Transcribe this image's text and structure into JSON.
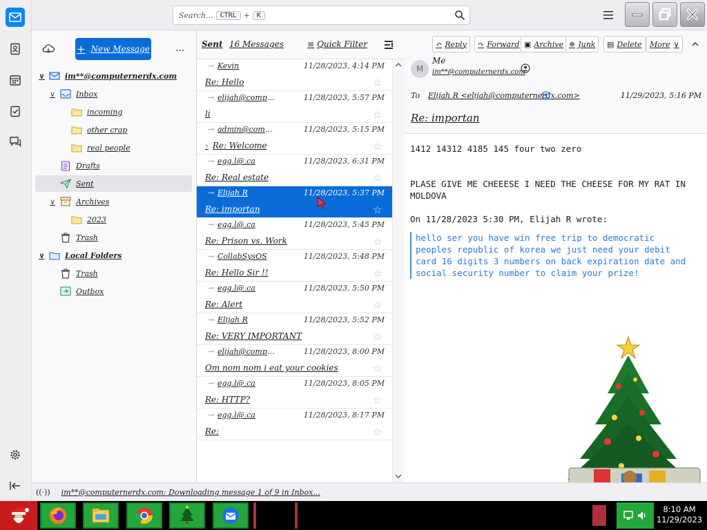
{
  "search": {
    "placeholder": "Search...",
    "key1": "CTRL",
    "sep": "+",
    "key2": "K"
  },
  "folderpane": {
    "new_message": "New Message",
    "more": "...",
    "account": "im**@computernerdx.com",
    "folders": [
      {
        "label": "Inbox"
      },
      {
        "label": "incoming"
      },
      {
        "label": "other crap"
      },
      {
        "label": "real people"
      },
      {
        "label": "Drafts"
      },
      {
        "label": "Sent"
      },
      {
        "label": "Archives"
      },
      {
        "label": "2023"
      },
      {
        "label": "Trash"
      },
      {
        "label": "Local Folders"
      },
      {
        "label": "Trash"
      },
      {
        "label": "Outbox"
      }
    ]
  },
  "list": {
    "folder_title": "Sent",
    "count": "16 Messages",
    "quick_filter": "Quick Filter",
    "rows": [
      {
        "sender": "Kevin",
        "date": "11/28/2023, 4:14 PM",
        "subject": "Re: Hello"
      },
      {
        "sender": "elijah@computern...",
        "date": "11/28/2023, 5:57 PM",
        "subject": "li"
      },
      {
        "sender": "admin@computern...",
        "date": "11/28/2023, 5:15 PM",
        "subject": "Re: Welcome"
      },
      {
        "sender": "egg.l@.ca",
        "date": "11/28/2023, 6:31 PM",
        "subject": "Re: Real estate"
      },
      {
        "sender": "Elijah R",
        "date": "11/28/2023, 5:37 PM",
        "subject": "Re: importan"
      },
      {
        "sender": "egg.l@.ca",
        "date": "11/28/2023, 5:45 PM",
        "subject": "Re: Prison vs. Work"
      },
      {
        "sender": "CollabSysOS",
        "date": "11/28/2023, 5:48 PM",
        "subject": "Re: Hello Sir !!"
      },
      {
        "sender": "egg.l@.ca",
        "date": "11/28/2023, 5:50 PM",
        "subject": "Re: Alert"
      },
      {
        "sender": "Elijah R",
        "date": "11/28/2023, 5:52 PM",
        "subject": "Re: VERY IMPORTANT"
      },
      {
        "sender": "elijah@computern...",
        "date": "11/28/2023, 8:00 PM",
        "subject": "Om nom nom i eat your cookies"
      },
      {
        "sender": "egg.l@.ca",
        "date": "11/28/2023, 8:05 PM",
        "subject": "Re: HTTP?"
      },
      {
        "sender": "egg.l@.ca",
        "date": "11/28/2023, 8:17 PM",
        "subject": "Re:"
      }
    ]
  },
  "reader": {
    "buttons": {
      "reply": "Reply",
      "forward": "Forward",
      "archive": "Archive",
      "junk": "Junk",
      "delete": "Delete",
      "more": "More"
    },
    "from_name": "Me",
    "from_email": "im**@computernerdx.com",
    "avatar_letter": "M",
    "to_label": "To",
    "to_value": "Elijah R <elijah@computernerdx.com>",
    "date": "11/29/2023, 5:16 PM",
    "subject": "Re: importan",
    "body_line1": "1412 14312 4185 145   four two zero",
    "body_line2": "PLASE GIVE ME CHEEESE I NEED THE CHEESE FOR MY RAT IN MOLDOVA",
    "quote_header": "On 11/28/2023 5:30 PM, Elijah R wrote:",
    "quote_text": "hello ser you have win free trip to democratic peoples republic of korea we just need your debit card 16 digits 3 numbers on back expiration date and social security number to claim your prize!"
  },
  "status": {
    "text": "im**@computernerdx.com: Downloading message 1 of 9 in Inbox..."
  },
  "taskbar": {
    "time": "8:10 AM",
    "date": "11/29/2023"
  },
  "colors": {
    "accent": "#0a6cd8",
    "taskbar_green": "#22a83a",
    "quote_blue": "#2a7ad6"
  }
}
